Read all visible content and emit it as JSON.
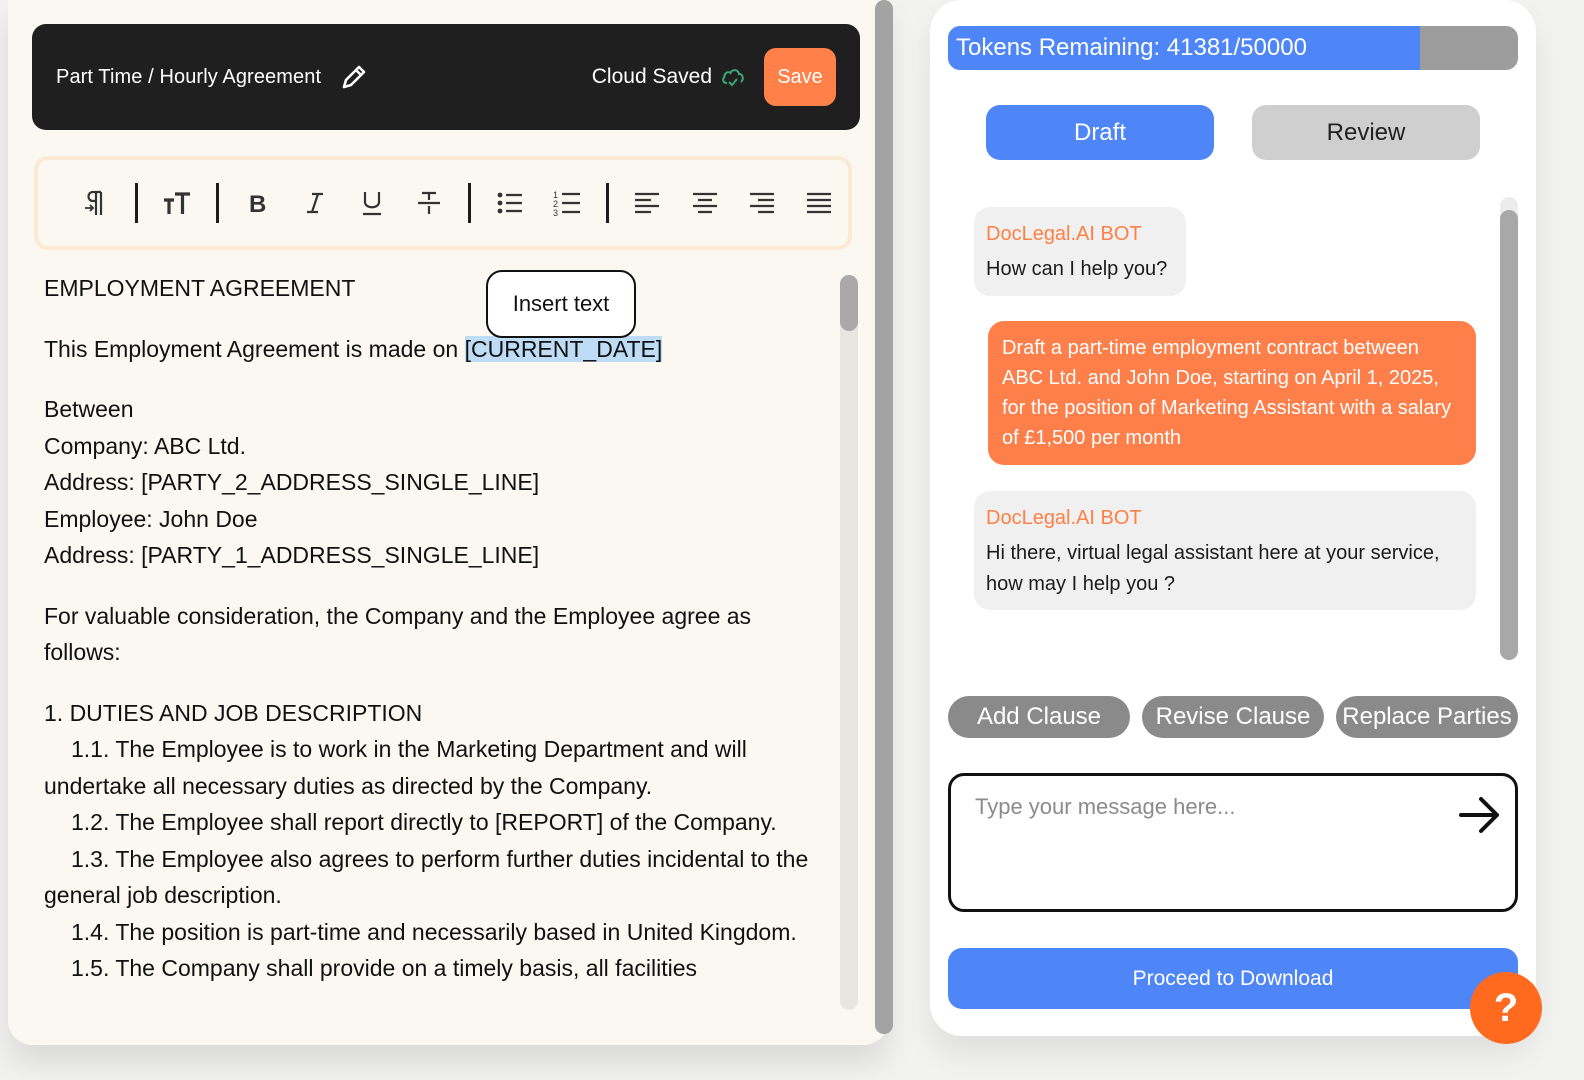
{
  "editor": {
    "doc_title": "Part Time / Hourly Agreement",
    "cloud_status": "Cloud Saved",
    "save_label": "Save",
    "insert_tooltip": "Insert text",
    "content": {
      "heading": "EMPLOYMENT AGREEMENT",
      "made_on_prefix": "This Employment Agreement is made on ",
      "made_on_value": "[CURRENT_DATE]",
      "between": "Between",
      "company_line": "Company: ABC Ltd.",
      "party2_address": "Address: [PARTY_2_ADDRESS_SINGLE_LINE]",
      "employee_line": "Employee: John Doe",
      "party1_address": "Address: [PARTY_1_ADDRESS_SINGLE_LINE]",
      "consideration": "For valuable consideration, the Company and the Employee agree as follows:",
      "section1_heading": "1. DUTIES AND JOB DESCRIPTION",
      "clause_1_1": "1.1. The Employee is to work in the Marketing Department and will undertake all necessary duties as directed by the Company.",
      "clause_1_2": "1.2. The Employee shall report directly to [REPORT] of the Company.",
      "clause_1_3": "1.3. The Employee also agrees to perform further duties incidental to the general job description.",
      "clause_1_4": "1.4. The position is part-time and necessarily based in United Kingdom.",
      "clause_1_5": "1.5. The Company shall provide on a timely basis, all facilities"
    }
  },
  "chat": {
    "tokens_label": "Tokens Remaining: 41381/50000",
    "tokens_fraction": 0.8276,
    "tabs": {
      "draft": "Draft",
      "review": "Review"
    },
    "messages": [
      {
        "sender": "DocLegal.AI BOT",
        "text": "How can I help you?"
      },
      {
        "sender": "user",
        "text": "Draft a part-time employment contract between ABC Ltd. and John Doe, starting on April 1, 2025, for the position of Marketing Assistant with a salary of £1,500 per month"
      },
      {
        "sender": "DocLegal.AI BOT",
        "text": "Hi there, virtual legal assistant here at your service, how may I help you ?"
      }
    ],
    "actions": {
      "add": "Add Clause",
      "revise": "Revise Clause",
      "replace": "Replace Parties"
    },
    "input_placeholder": "Type your message here...",
    "download_label": "Proceed to Download",
    "help_label": "?"
  },
  "colors": {
    "accent_blue": "#4f86f7",
    "accent_orange": "#ff7f4b",
    "header_dark": "#1f1f1f",
    "help_orange": "#ff6a1f"
  },
  "icons": {
    "edit": "pencil-icon",
    "cloud": "cloud-check-icon",
    "send": "arrow-right-icon",
    "toolbar": [
      "paragraph-icon",
      "text-size-icon",
      "bold-icon",
      "italic-icon",
      "underline-icon",
      "strikethrough-icon",
      "bullet-list-icon",
      "numbered-list-icon",
      "align-left-icon",
      "align-center-icon",
      "align-right-icon",
      "align-justify-icon"
    ]
  }
}
